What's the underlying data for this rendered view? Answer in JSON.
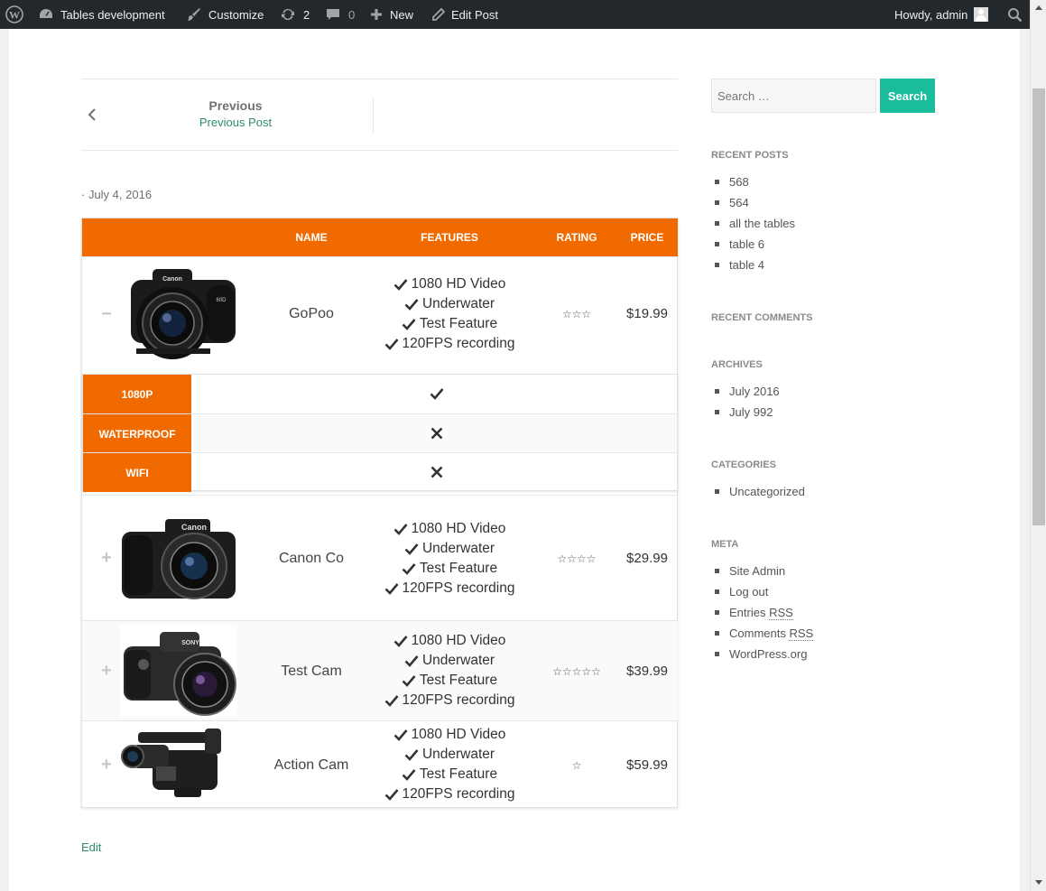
{
  "adminbar": {
    "site_name": "Tables development",
    "customize": "Customize",
    "updates_count": "2",
    "comments_count": "0",
    "new_label": "New",
    "edit_post": "Edit Post",
    "greeting": "Howdy, admin"
  },
  "post_nav": {
    "label": "Previous",
    "title": "Previous Post"
  },
  "post_date": "· July 4, 2016",
  "table": {
    "headers": {
      "name": "NAME",
      "features": "FEATURES",
      "rating": "RATING",
      "price": "PRICE"
    },
    "rows": [
      {
        "toggle": "−",
        "image": "canon-dslr-camera",
        "name": "GoPoo",
        "features": [
          "1080 HD Video",
          "Underwater",
          "Test Feature",
          "120FPS recording"
        ],
        "rating": "☆☆☆",
        "price": "$19.99"
      },
      {
        "toggle": "+",
        "image": "canon-bridge-camera",
        "name": "Canon Co",
        "features": [
          "1080 HD Video",
          "Underwater",
          "Test Feature",
          "120FPS recording"
        ],
        "rating": "☆☆☆☆",
        "price": "$29.99"
      },
      {
        "toggle": "+",
        "image": "sony-bridge-camera",
        "name": "Test Cam",
        "features": [
          "1080 HD Video",
          "Underwater",
          "Test Feature",
          "120FPS recording"
        ],
        "rating": "☆☆☆☆☆",
        "price": "$39.99"
      },
      {
        "toggle": "+",
        "image": "camcorder",
        "name": "Action Cam",
        "features": [
          "1080 HD Video",
          "Underwater",
          "Test Feature",
          "120FPS recording"
        ],
        "rating": "☆",
        "price": "$59.99"
      }
    ],
    "details": [
      {
        "label": "1080P",
        "value": "check-icon"
      },
      {
        "label": "WATERPROOF",
        "value": "cross-icon"
      },
      {
        "label": "WIFI",
        "value": "cross-icon"
      }
    ]
  },
  "edit_link": "Edit",
  "sidebar": {
    "search_placeholder": "Search …",
    "search_button": "Search",
    "recent_posts_title": "RECENT POSTS",
    "recent_posts": [
      "568",
      "564",
      "all the tables",
      "table 6",
      "table 4"
    ],
    "recent_comments_title": "RECENT COMMENTS",
    "archives_title": "ARCHIVES",
    "archives": [
      "July 2016",
      "July 992"
    ],
    "categories_title": "CATEGORIES",
    "categories": [
      "Uncategorized"
    ],
    "meta_title": "META",
    "meta": {
      "site_admin": "Site Admin",
      "log_out": "Log out",
      "entries": "Entries",
      "comments": "Comments",
      "rss": "RSS",
      "wordpress": "WordPress.org"
    }
  },
  "colors": {
    "accent": "#f06a00",
    "button": "#1abc9c",
    "link": "#2e8b6e",
    "adminbar": "#23282d"
  }
}
